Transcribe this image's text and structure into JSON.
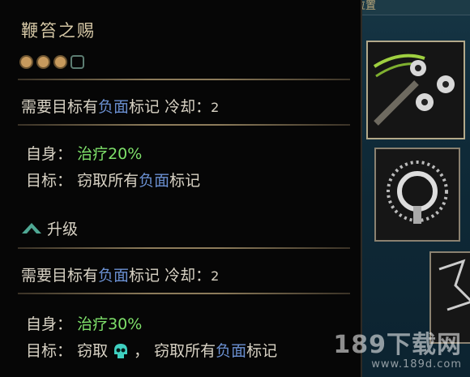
{
  "background": {
    "top_label": "位置"
  },
  "tooltip": {
    "title": "鞭笞之赐",
    "pips_filled": 3,
    "pips_total": 4,
    "base": {
      "req_prefix": "需要目标有",
      "req_negative": "负面",
      "req_suffix": "标记",
      "cooldown_label": "冷却：",
      "cooldown_value": "2",
      "self_label": "自身：",
      "self_effect": "治疗20%",
      "target_label": "目标：",
      "target_prefix": "窃取所有",
      "target_negative": "负面",
      "target_suffix": "标记"
    },
    "upgrade": {
      "label": "升级",
      "req_prefix": "需要目标有",
      "req_negative": "负面",
      "req_suffix": "标记",
      "cooldown_label": "冷却：",
      "cooldown_value": "2",
      "self_label": "自身：",
      "self_effect": "治疗30%",
      "target_label": "目标：",
      "target_steal": "窃取",
      "target_sep": "，",
      "target_prefix": "窃取所有",
      "target_negative": "负面",
      "target_suffix": "标记"
    }
  },
  "watermark": {
    "main": "189下载网",
    "sub": "www.189d.com"
  },
  "colors": {
    "negative": "#6a8fd0",
    "heal": "#7ee06a",
    "pip": "#c79a5d",
    "title": "#d6c8a6"
  }
}
